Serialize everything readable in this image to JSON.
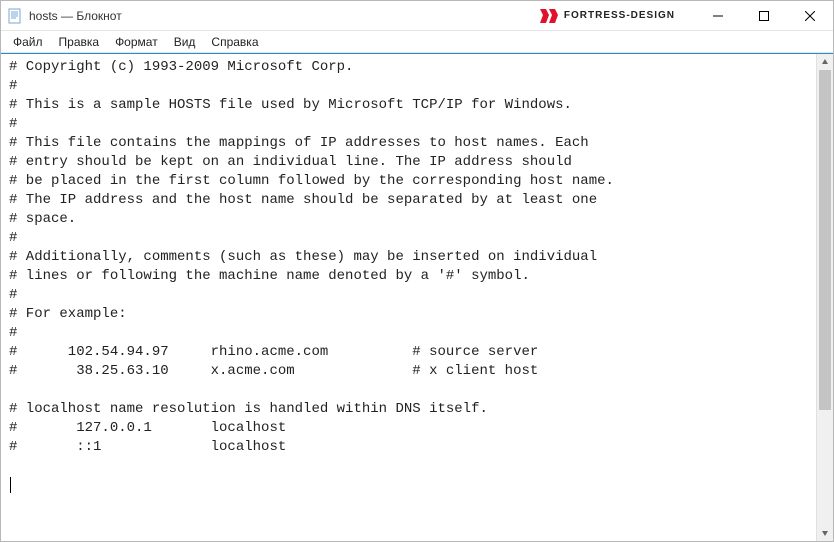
{
  "window": {
    "title": "hosts — Блокнот",
    "brand": "FORTRESS-DESIGN"
  },
  "menubar": {
    "items": [
      "Файл",
      "Правка",
      "Формат",
      "Вид",
      "Справка"
    ]
  },
  "editor": {
    "content": "# Copyright (c) 1993-2009 Microsoft Corp.\n#\n# This is a sample HOSTS file used by Microsoft TCP/IP for Windows.\n#\n# This file contains the mappings of IP addresses to host names. Each\n# entry should be kept on an individual line. The IP address should\n# be placed in the first column followed by the corresponding host name.\n# The IP address and the host name should be separated by at least one\n# space.\n#\n# Additionally, comments (such as these) may be inserted on individual\n# lines or following the machine name denoted by a '#' symbol.\n#\n# For example:\n#\n#      102.54.94.97     rhino.acme.com          # source server\n#       38.25.63.10     x.acme.com              # x client host\n\n# localhost name resolution is handled within DNS itself.\n#       127.0.0.1       localhost\n#       ::1             localhost\n"
  }
}
